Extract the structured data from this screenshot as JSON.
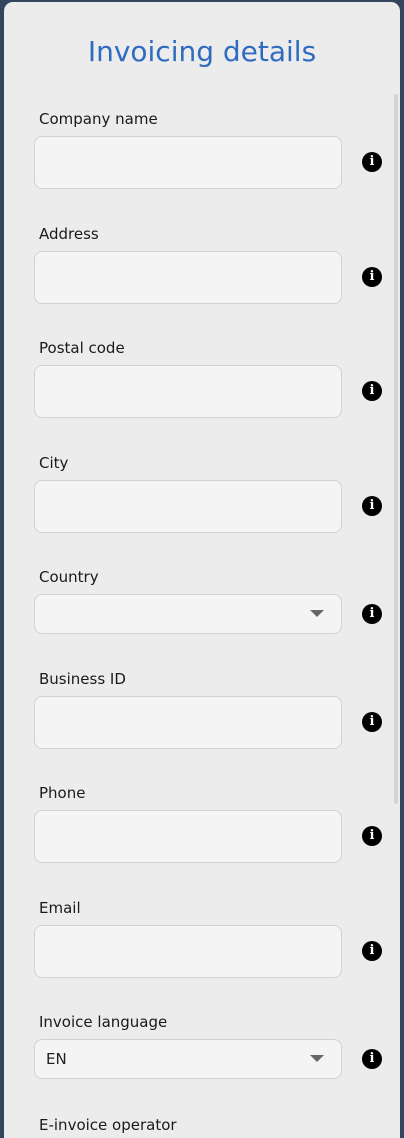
{
  "title": "Invoicing details",
  "info_glyph": "i",
  "fields": [
    {
      "label": "Company name",
      "type": "text",
      "value": ""
    },
    {
      "label": "Address",
      "type": "text",
      "value": ""
    },
    {
      "label": "Postal code",
      "type": "text",
      "value": ""
    },
    {
      "label": "City",
      "type": "text",
      "value": ""
    },
    {
      "label": "Country",
      "type": "select",
      "value": ""
    },
    {
      "label": "Business ID",
      "type": "text",
      "value": ""
    },
    {
      "label": "Phone",
      "type": "text",
      "value": ""
    },
    {
      "label": "Email",
      "type": "text",
      "value": ""
    },
    {
      "label": "Invoice language",
      "type": "select",
      "value": "EN"
    },
    {
      "label": "E-invoice operator",
      "type": "select",
      "value": ""
    }
  ],
  "icons": {
    "info": "info-icon",
    "dropdown": "chevron-down-icon"
  },
  "colors": {
    "background": "#34465d",
    "panel": "#ececec",
    "title": "#2f6cc0",
    "input_bg": "#f4f4f4",
    "input_border": "#d2d2d2"
  }
}
